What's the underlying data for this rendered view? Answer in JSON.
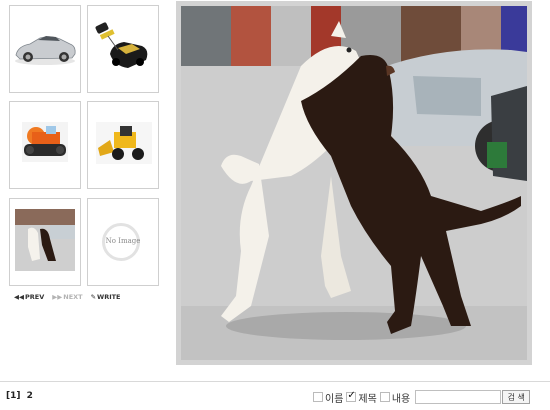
{
  "thumbnails": [
    {
      "subject": "silver convertible car"
    },
    {
      "subject": "black toy car with remote"
    },
    {
      "subject": "orange toy bulldozer"
    },
    {
      "subject": "yellow toy front loader"
    },
    {
      "subject": "dogs playing photo"
    },
    {
      "subject": "placeholder",
      "placeholder_text": "No Image"
    }
  ],
  "nav": {
    "prev_label": "PREV",
    "next_label": "NEXT",
    "write_label": "WRITE"
  },
  "main_photo": {
    "subject": "two dogs hugging in a parking lot"
  },
  "pager": {
    "current": "[1]",
    "other": "2"
  },
  "search": {
    "opt_name": "이름",
    "opt_title": "제목",
    "opt_content": "내용",
    "opt_name_checked": false,
    "opt_title_checked": true,
    "opt_content_checked": false,
    "input_value": "",
    "button_label": "검 색"
  },
  "colors": {
    "frame": "#d3d3d3",
    "border": "#cfcfcf",
    "nav_disabled": "#b3b3b3"
  }
}
